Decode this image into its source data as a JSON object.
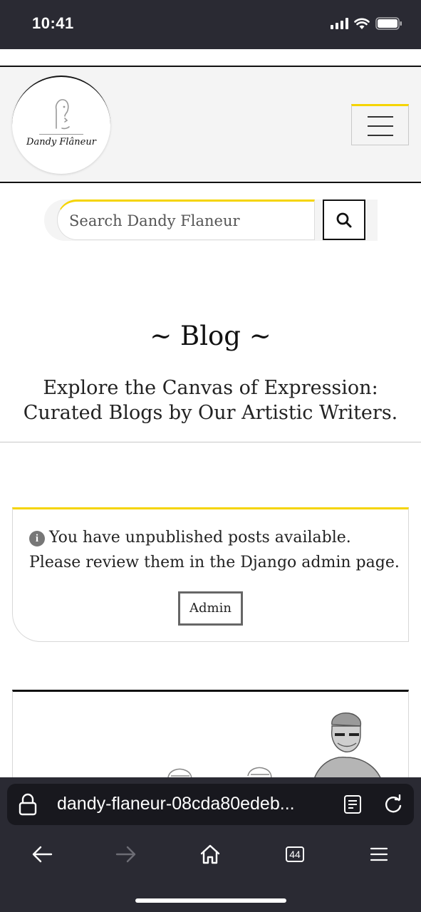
{
  "status_bar": {
    "time": "10:41"
  },
  "site": {
    "logo_text": "Dandy Flâneur",
    "search": {
      "placeholder": "Search Dandy Flaneur"
    },
    "blog_title": "~ Blog ~",
    "blog_subtitle": "Explore the Canvas of Expression: Curated Blogs by Our Artistic Writers.",
    "notice": {
      "info_icon_glyph": "i",
      "message": "You have unpublished posts available. Please review them in the Django admin page.",
      "admin_button": "Admin"
    }
  },
  "browser": {
    "url": "dandy-flaneur-08cda80edeb...",
    "tab_count": "44"
  },
  "colors": {
    "accent_yellow": "#f5d400",
    "chrome_dark": "#2a2a33",
    "header_bg": "#f4f4f4"
  }
}
